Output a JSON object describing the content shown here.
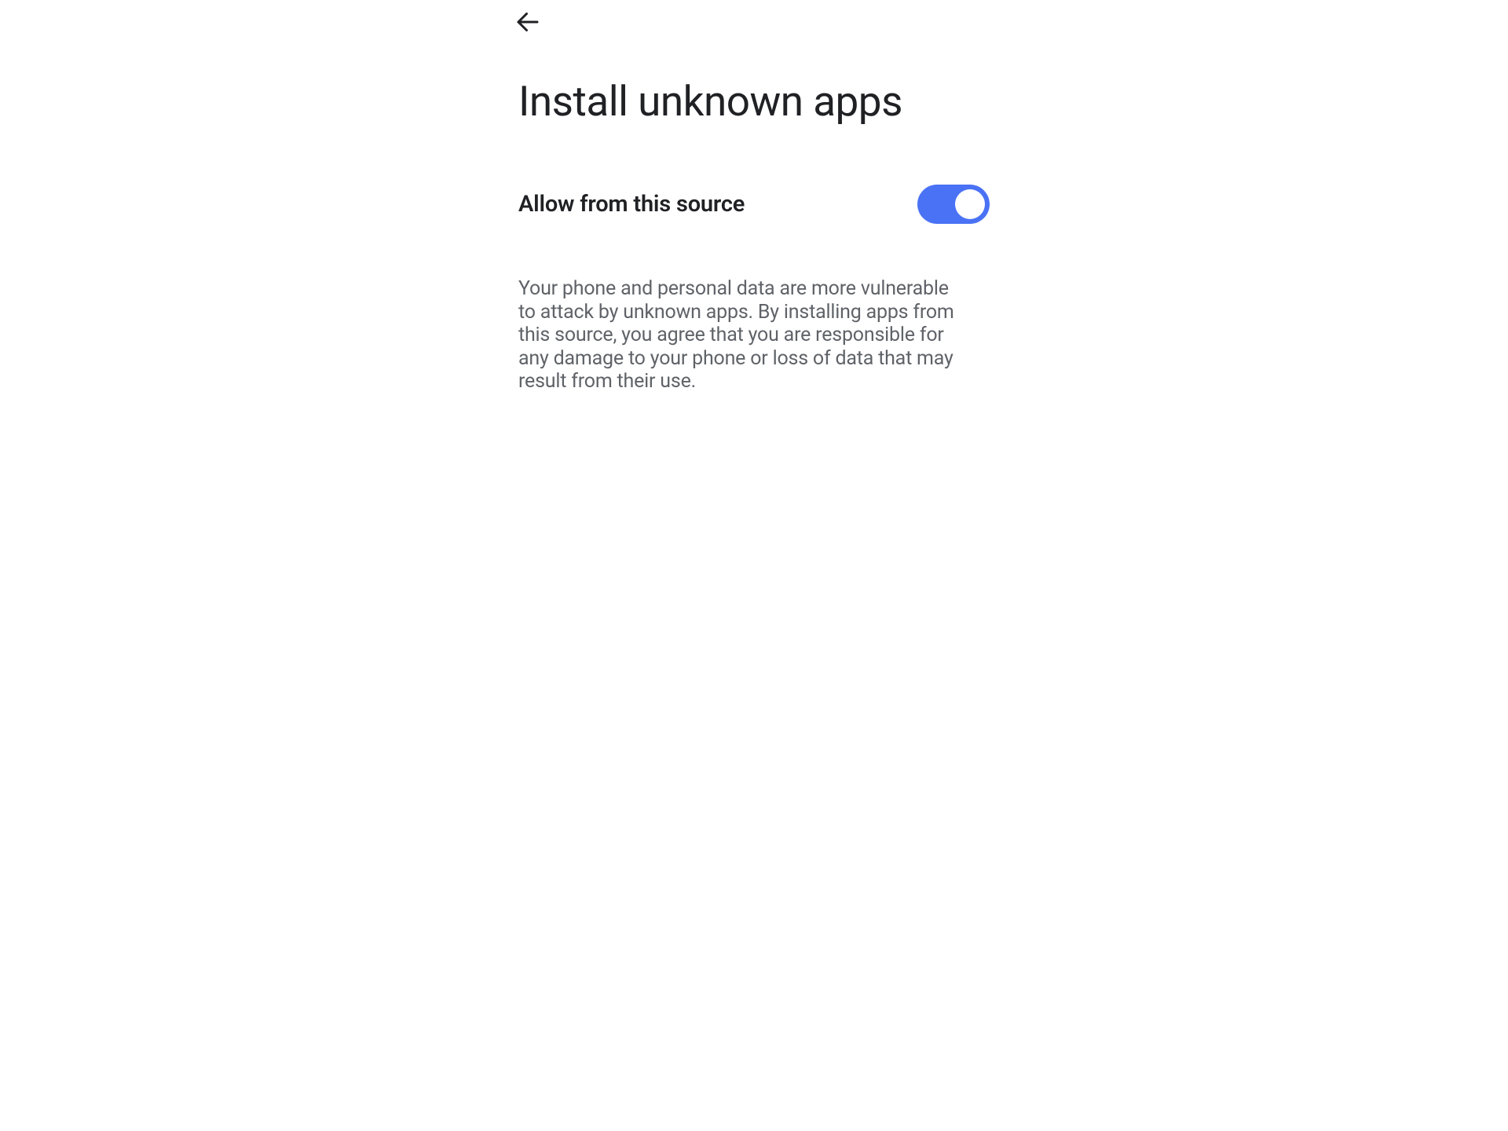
{
  "header": {
    "title": "Install unknown apps"
  },
  "setting": {
    "label": "Allow from this source",
    "enabled": true
  },
  "description": "Your phone and personal data are more vulnerable to attack by unknown apps. By installing apps from this source, you agree that you are responsible for any damage to your phone or loss of data that may result from their use.",
  "colors": {
    "toggle_on": "#4a72f5"
  }
}
